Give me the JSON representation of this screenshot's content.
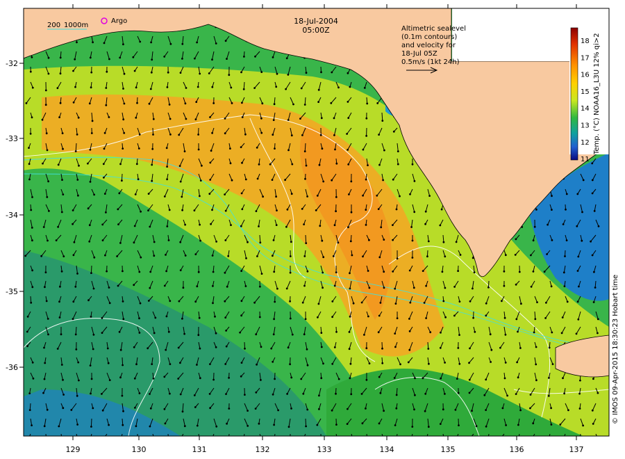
{
  "map": {
    "date": "18-Jul-2004",
    "time": "05:00Z",
    "legend": {
      "isobath_label": "200",
      "isobath_label2": "1000m",
      "argo_label": "Argo"
    },
    "annotation": [
      "Altimetric sealevel",
      "(0.1m contours)",
      "and velocity for",
      "18-Jul 05Z",
      "0.5m/s (1kt 24h)"
    ],
    "colorbar": {
      "label": "Temp. (°C) NOAA16_L3U 12% qi>2",
      "ticks": [
        "18",
        "17",
        "16",
        "15",
        "14",
        "13",
        "12",
        "11"
      ],
      "colors": [
        "#8b0000",
        "#e03000",
        "#ff8c00",
        "#ffd000",
        "#cfe800",
        "#3cc040",
        "#10a0a0",
        "#2060d0",
        "#0a0a80"
      ]
    },
    "credit": "© IMOS 09-Apr-2015 18:30:23 Hobart time",
    "lon_ticks": [
      "129",
      "130",
      "131",
      "132",
      "133",
      "134",
      "135",
      "136",
      "137"
    ],
    "lat_ticks": [
      "-32",
      "-33",
      "-34",
      "-35",
      "-36"
    ],
    "colors": {
      "land": "#f8c9a0",
      "warm": "#f5a623",
      "mid": "#c8e020",
      "cool": "#2faa3a",
      "cold": "#1e7fc8"
    }
  }
}
